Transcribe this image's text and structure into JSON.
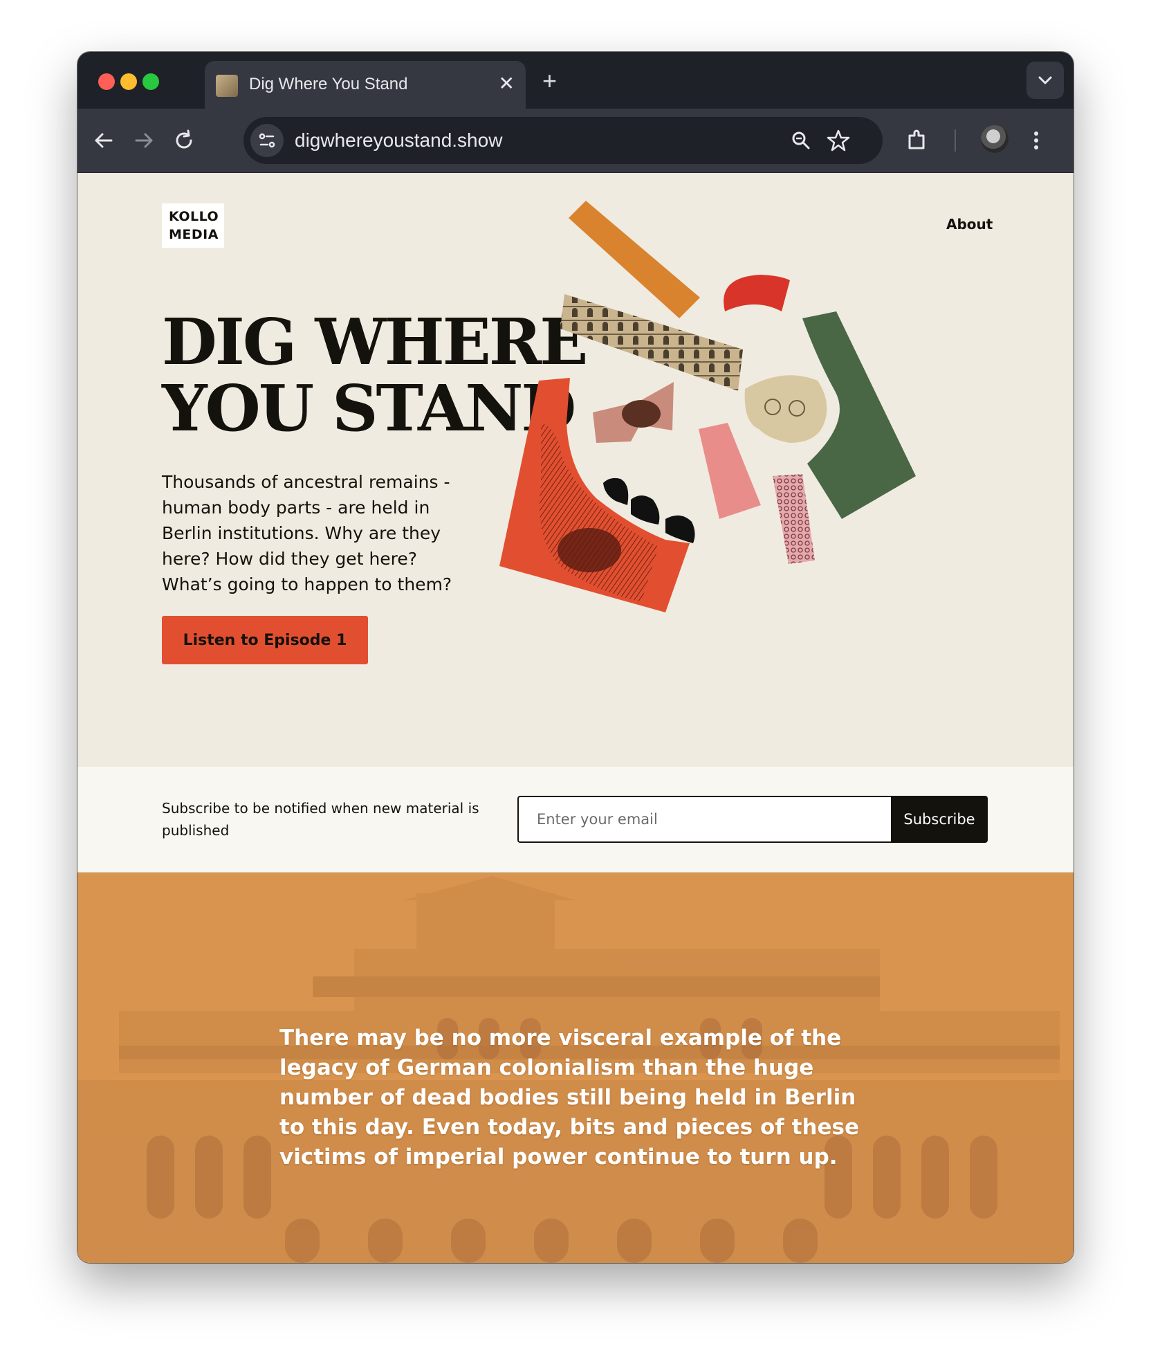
{
  "browser": {
    "tab_title": "Dig Where You Stand",
    "tab_close": "✕",
    "new_tab": "+",
    "url": "digwhereyoustand.show",
    "icons": [
      "back-arrow-icon",
      "forward-arrow-icon",
      "reload-icon",
      "site-settings-icon",
      "zoom-icon",
      "bookmark-star-icon",
      "extensions-icon",
      "profile-avatar",
      "more-menu-icon",
      "tab-search-chevron-icon"
    ]
  },
  "header": {
    "logo_line1": "KOLLO",
    "logo_line2": "MEDIA",
    "nav_about": "About"
  },
  "hero": {
    "title_line1": "DIG WHERE",
    "title_line2": "YOU STAND",
    "description": "Thousands of ancestral remains - human body parts - are held in Berlin institutions. Why are they here? How did they get here? What’s going to happen to them?",
    "cta_label": "Listen to Episode 1"
  },
  "subscribe": {
    "text": "Subscribe to be notified when new material is published",
    "placeholder": "Enter your email",
    "button_label": "Subscribe"
  },
  "quote": {
    "text": "There may be no more visceral example of the legacy of German colonialism than the huge number of dead bodies still being held in Berlin to this day. Even today, bits and pieces of these victims of imperial power continue to turn up."
  },
  "colors": {
    "page_bg": "#f0ebe0",
    "ink": "#14120d",
    "accent_red": "#e24f30",
    "orange": "#d9832f",
    "green": "#4a6745",
    "pink": "#e98d8a",
    "quote_band": "#d99550"
  }
}
